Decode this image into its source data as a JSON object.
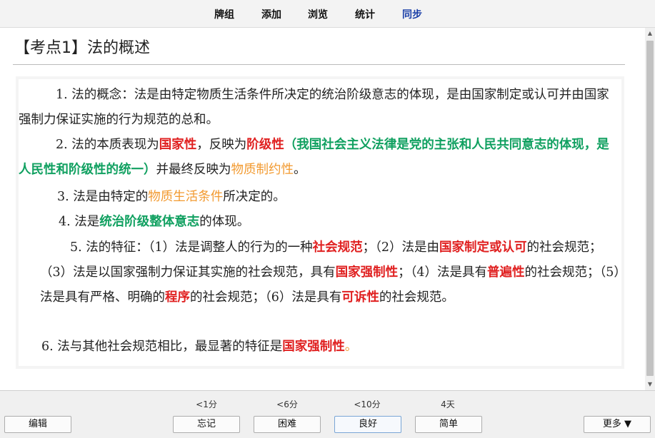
{
  "menu": {
    "decks": "牌组",
    "add": "添加",
    "browse": "浏览",
    "stats": "统计",
    "sync": "同步"
  },
  "card": {
    "title": "【考点1】法的概述",
    "p1": {
      "text": "1. 法的概念：法是由特定物质生活条件所决定的统治阶级意志的体现，是由国家制定或认可并由国家强制力保证实施的行为规范的总和。"
    },
    "p2": {
      "a": "2. 法的本质表现为",
      "b": "国家性",
      "c": "，反映为",
      "d": "阶级性",
      "e": "（我国社会主义法律是党的主张和人民共同意志的体现，是人民性和阶级性的统一）",
      "f": "并最终反映为",
      "g": "物质制约性",
      "h": "。"
    },
    "p3": {
      "a": "3. 法是由特定的",
      "b": "物质生活条件",
      "c": "所决定的。"
    },
    "p4": {
      "a": "4. 法是",
      "b": "统治阶级整体意志",
      "c": "的体现。"
    },
    "p5": {
      "a": "5. 法的特征：（1）法是调整人的行为的一种",
      "b": "社会规范",
      "c": "；（2）法是由",
      "d": "国家制定或认可",
      "e": "的社会规范；（3）法是以国家强制力保证其实施的社会规范，具有",
      "f": "国家强制性",
      "g": "；（4）法是具有",
      "h": "普遍性",
      "i": "的社会规范；（5）法是具有严格、明确的",
      "j": "程序",
      "k": "的社会规范；（6）法是具有",
      "l": "可诉性",
      "m": "的社会规范。"
    },
    "p6": {
      "a": "6. 法与其他社会规范相比，最显著的特征是",
      "b": "国家强制性",
      "c": "。"
    }
  },
  "answer_bar": {
    "edit_label": "编辑",
    "more_label": "更多 ▼",
    "again": {
      "interval": "<1分",
      "label": "忘记"
    },
    "hard": {
      "interval": "<6分",
      "label": "困难"
    },
    "good": {
      "interval": "<10分",
      "label": "良好"
    },
    "easy": {
      "interval": "4天",
      "label": "简单"
    }
  },
  "colors": {
    "red": "#e02020",
    "green": "#10a060",
    "orange": "#f29a30",
    "sync": "#1a3fa8"
  }
}
